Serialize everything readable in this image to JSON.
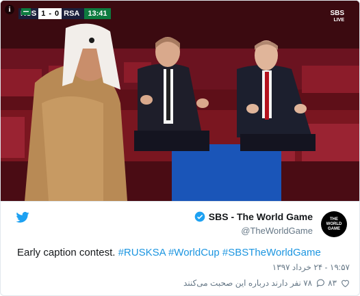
{
  "scoreboard": {
    "home": "RUS",
    "home_score": "1",
    "separator": "-",
    "away_score": "0",
    "away": "RSA",
    "clock": "13:41"
  },
  "broadcaster": {
    "name": "SBS",
    "subtitle": "LIVE"
  },
  "tweet": {
    "display_name": "SBS - The World Game",
    "handle": "@TheWorldGame",
    "avatar_text": "THE WORLD GAME",
    "text_plain": "Early caption contest.",
    "hashtags": [
      "#RUSKSA",
      "#WorldCup",
      "#SBSTheWorldGame"
    ],
    "timestamp": "۱۹:۵۷ - ۲۴ خرداد ۱۳۹۷",
    "likes": "۸۳",
    "replies_text": "۷۸ نفر دارند درباره این صحبت می‌کنند"
  },
  "colors": {
    "link": "#1b95e0",
    "twitter_blue": "#1da1f2",
    "stadium_red": "#7a1620"
  }
}
